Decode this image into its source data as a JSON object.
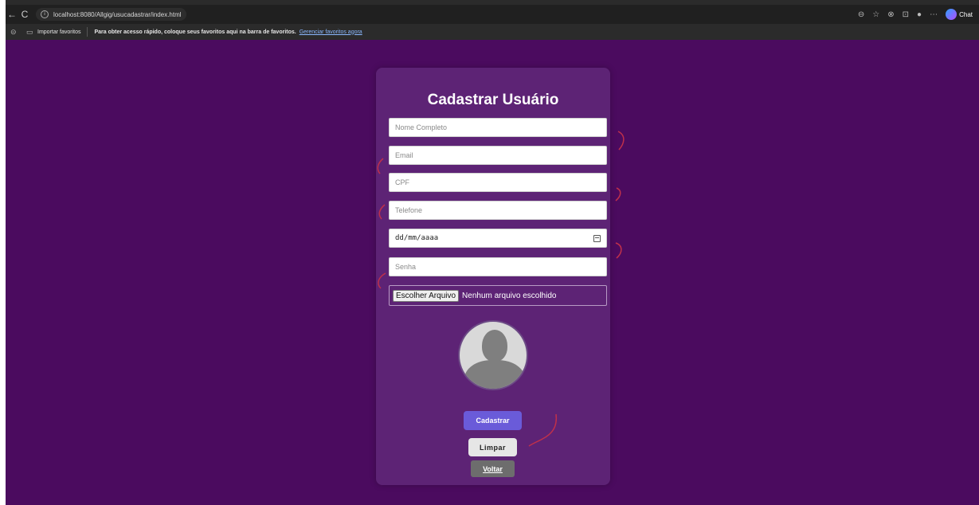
{
  "browser": {
    "back_glyph": "←",
    "reload_glyph": "C",
    "info_glyph": "i",
    "url": "localhost:8080/Allgig/usucadastrar/index.html",
    "chat_label": "Chat",
    "favorites_bar": {
      "import_label": "Importar favoritos",
      "prompt_text": "Para obter acesso rápido, coloque seus favoritos aqui na barra de favoritos.",
      "manage_link": "Gerenciar favoritos agora"
    }
  },
  "form": {
    "title": "Cadastrar Usuário",
    "name_placeholder": "Nome Completo",
    "email_placeholder": "Email",
    "cpf_placeholder": "CPF",
    "phone_placeholder": "Telefone",
    "date_value": "dd/mm/aaaa",
    "password_placeholder": "Senha",
    "file_button": "Escolher Arquivo",
    "file_status": "Nenhum arquivo escolhido",
    "submit_label": "Cadastrar",
    "clear_label": "Limpar",
    "back_label": "Voltar"
  },
  "colors": {
    "page_bg": "#4b0b5f",
    "card_bg": "#5d2375",
    "submit_bg": "#6a5bd9",
    "annotation": "#c0304a"
  }
}
